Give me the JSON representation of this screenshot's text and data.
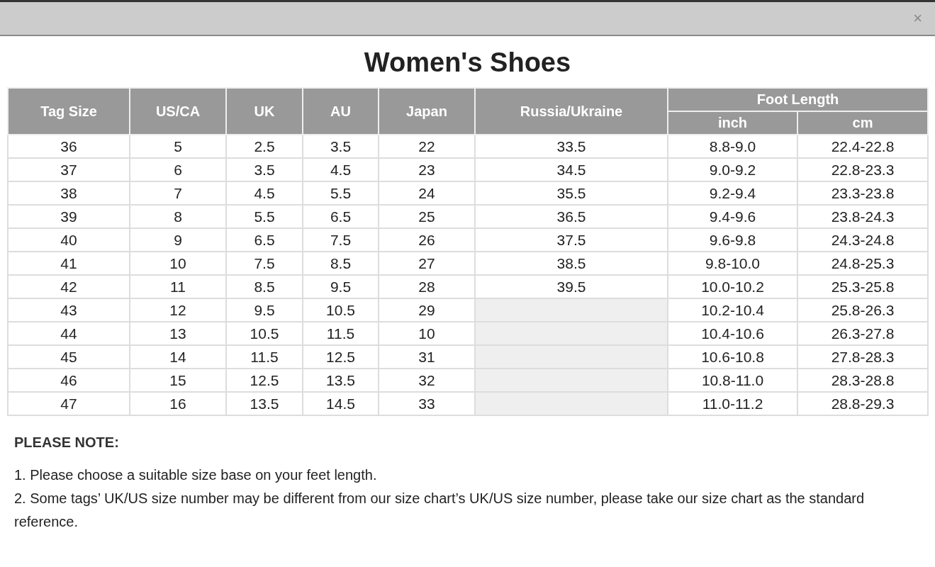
{
  "dialog": {
    "close_label": "×"
  },
  "title": "Women's Shoes",
  "table": {
    "columns": [
      "Tag Size",
      "US/CA",
      "UK",
      "AU",
      "Japan",
      "Russia/Ukraine"
    ],
    "group": {
      "label": "Foot Length",
      "columns": [
        "inch",
        "cm"
      ]
    },
    "rows": [
      {
        "tag": "36",
        "us_ca": "5",
        "uk": "2.5",
        "au": "3.5",
        "japan": "22",
        "russia_ukraine": "33.5",
        "inch": "8.8-9.0",
        "cm": "22.4-22.8"
      },
      {
        "tag": "37",
        "us_ca": "6",
        "uk": "3.5",
        "au": "4.5",
        "japan": "23",
        "russia_ukraine": "34.5",
        "inch": "9.0-9.2",
        "cm": "22.8-23.3"
      },
      {
        "tag": "38",
        "us_ca": "7",
        "uk": "4.5",
        "au": "5.5",
        "japan": "24",
        "russia_ukraine": "35.5",
        "inch": "9.2-9.4",
        "cm": "23.3-23.8"
      },
      {
        "tag": "39",
        "us_ca": "8",
        "uk": "5.5",
        "au": "6.5",
        "japan": "25",
        "russia_ukraine": "36.5",
        "inch": "9.4-9.6",
        "cm": "23.8-24.3"
      },
      {
        "tag": "40",
        "us_ca": "9",
        "uk": "6.5",
        "au": "7.5",
        "japan": "26",
        "russia_ukraine": "37.5",
        "inch": "9.6-9.8",
        "cm": "24.3-24.8"
      },
      {
        "tag": "41",
        "us_ca": "10",
        "uk": "7.5",
        "au": "8.5",
        "japan": "27",
        "russia_ukraine": "38.5",
        "inch": "9.8-10.0",
        "cm": "24.8-25.3"
      },
      {
        "tag": "42",
        "us_ca": "11",
        "uk": "8.5",
        "au": "9.5",
        "japan": "28",
        "russia_ukraine": "39.5",
        "inch": "10.0-10.2",
        "cm": "25.3-25.8"
      },
      {
        "tag": "43",
        "us_ca": "12",
        "uk": "9.5",
        "au": "10.5",
        "japan": "29",
        "inch": "10.2-10.4",
        "cm": "25.8-26.3"
      },
      {
        "tag": "44",
        "us_ca": "13",
        "uk": "10.5",
        "au": "11.5",
        "japan": "10",
        "inch": "10.4-10.6",
        "cm": "26.3-27.8"
      },
      {
        "tag": "45",
        "us_ca": "14",
        "uk": "11.5",
        "au": "12.5",
        "japan": "31",
        "inch": "10.6-10.8",
        "cm": "27.8-28.3"
      },
      {
        "tag": "46",
        "us_ca": "15",
        "uk": "12.5",
        "au": "13.5",
        "japan": "32",
        "inch": "10.8-11.0",
        "cm": "28.3-28.8"
      },
      {
        "tag": "47",
        "us_ca": "16",
        "uk": "13.5",
        "au": "14.5",
        "japan": "33",
        "inch": "11.0-11.2",
        "cm": "28.8-29.3"
      }
    ]
  },
  "note": {
    "heading": "PLEASE NOTE:",
    "lines": [
      "1. Please choose a suitable size base on your feet length.",
      "2. Some tags’ UK/US size number may be different from our size chart’s UK/US size number, please take our size chart as the standard reference."
    ]
  }
}
